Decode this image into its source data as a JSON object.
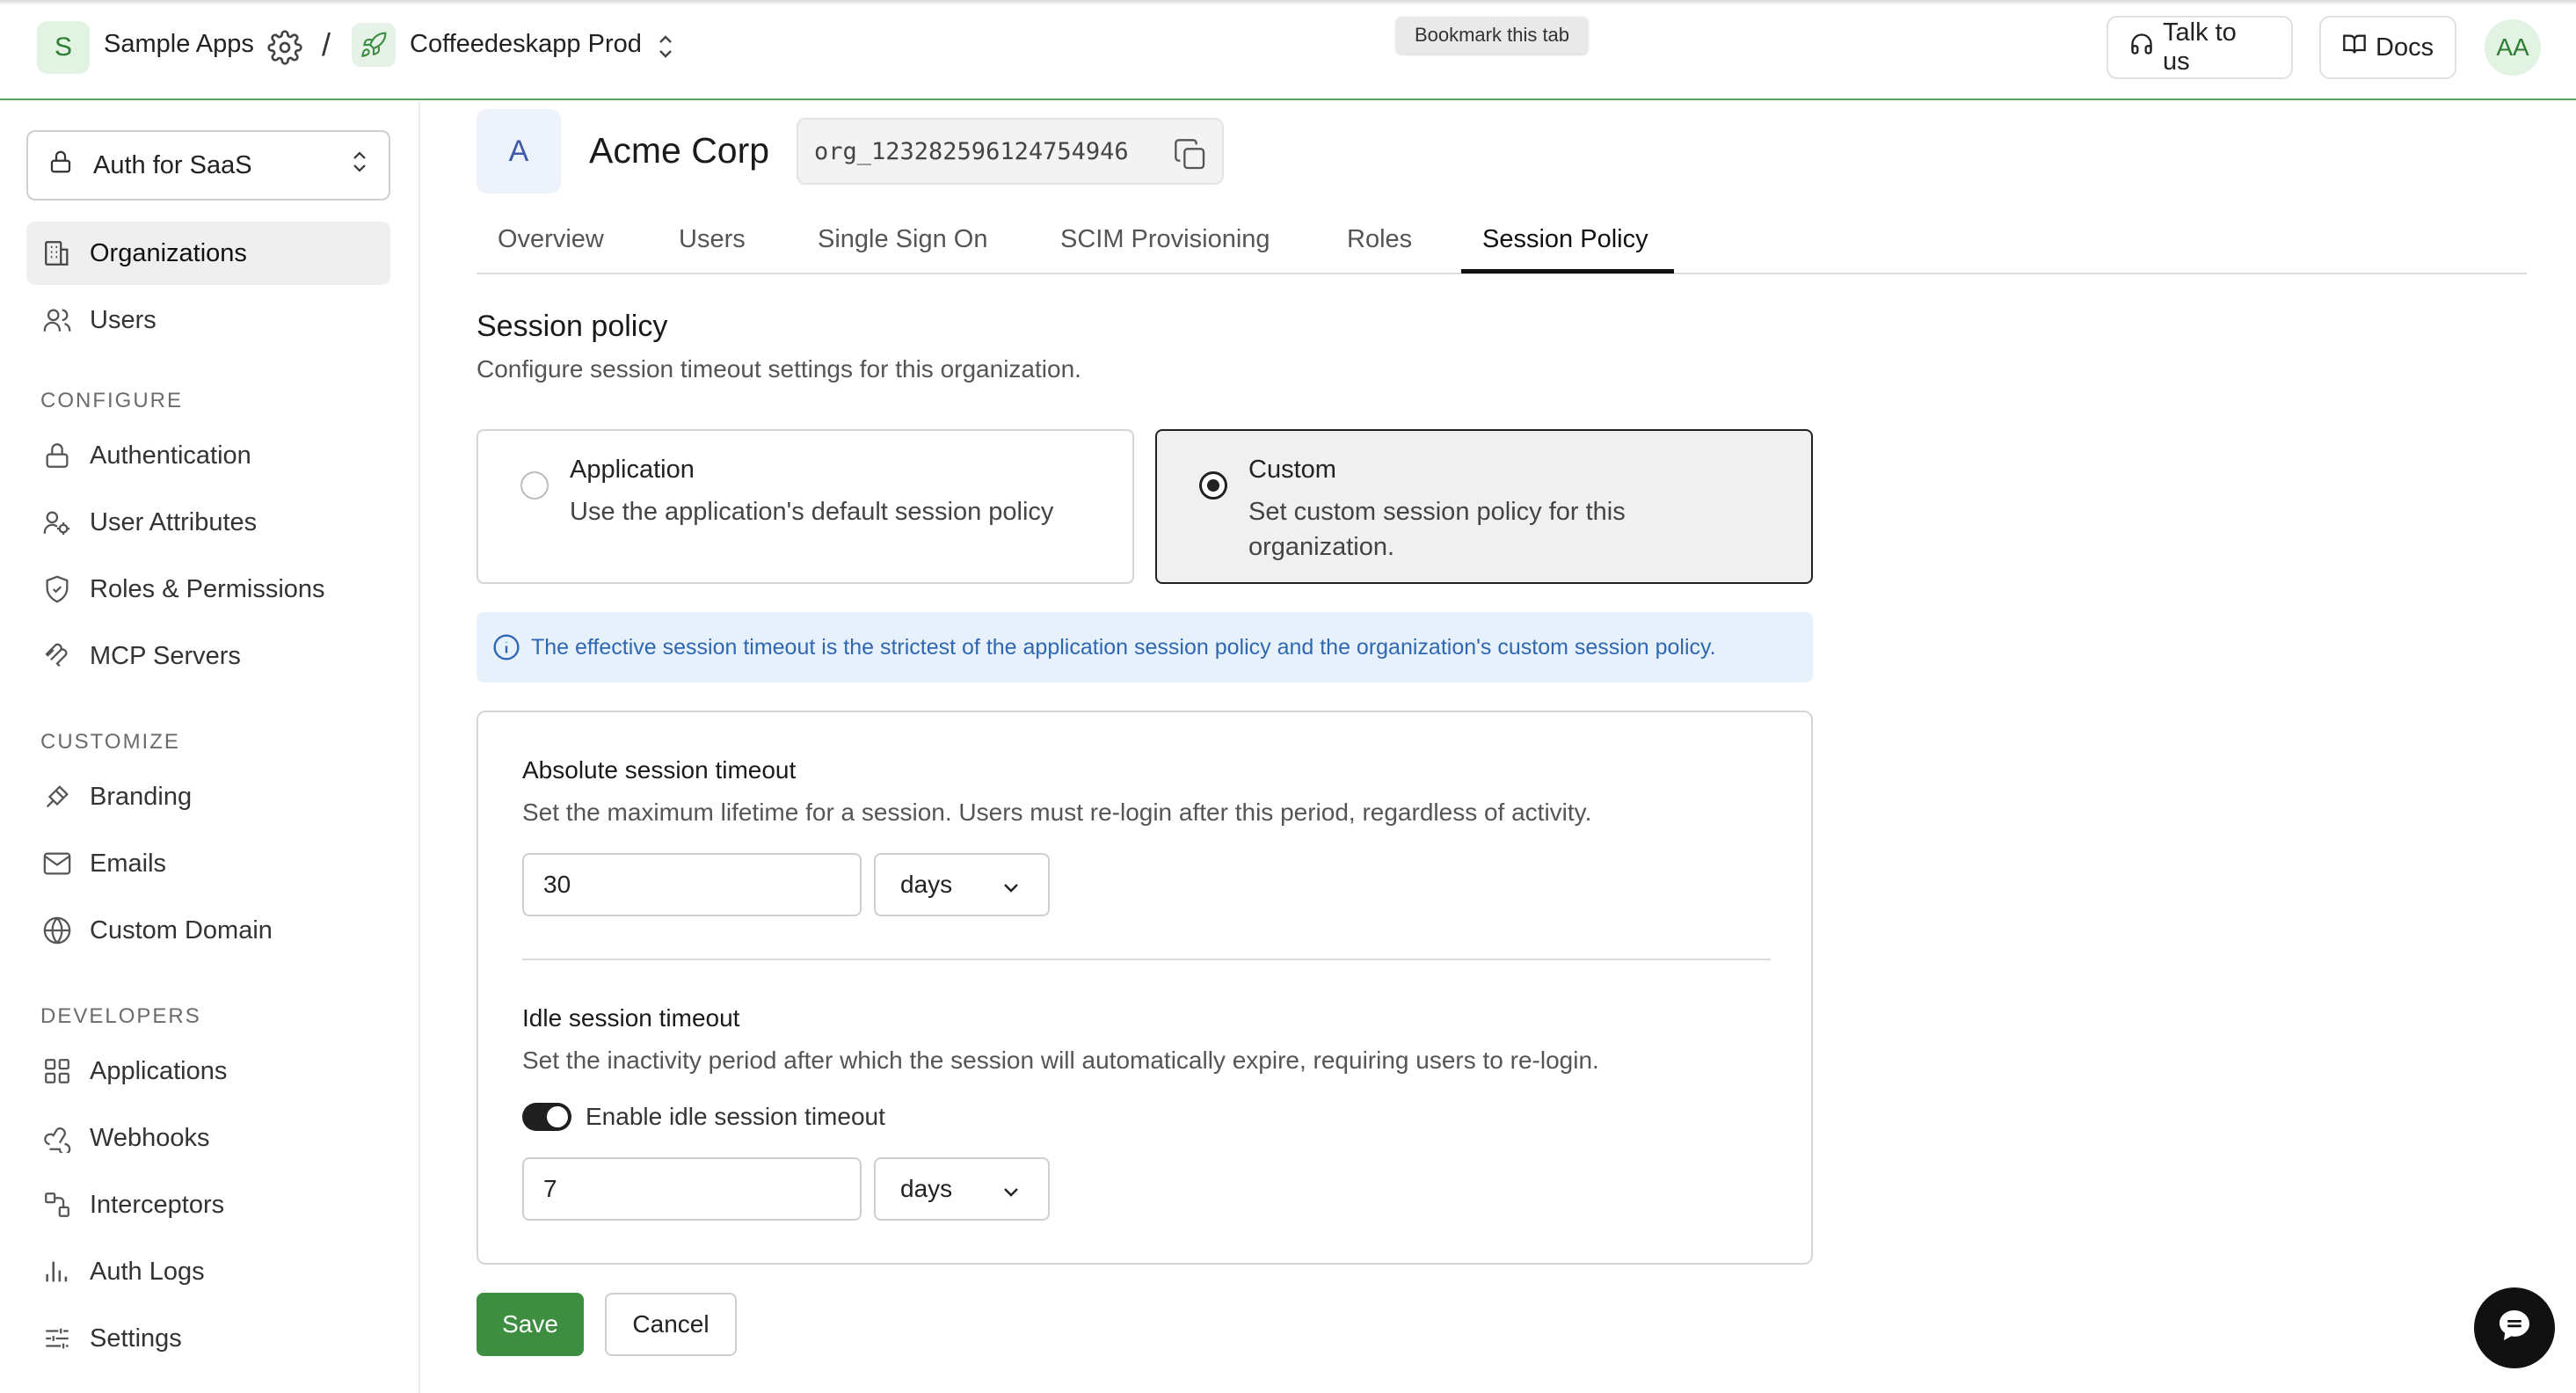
{
  "topbar": {
    "workspace_initial": "S",
    "workspace_name": "Sample Apps",
    "separator": "/",
    "environment_name": "Coffeedeskapp Prod",
    "tooltip": "Bookmark this tab",
    "talk_label": "Talk to us",
    "docs_label": "Docs",
    "user_initials": "AA"
  },
  "sidebar": {
    "app_selector": "Auth for SaaS",
    "primary": [
      {
        "label": "Organizations",
        "icon": "building-icon",
        "active": true
      },
      {
        "label": "Users",
        "icon": "users-icon",
        "active": false
      }
    ],
    "sections": [
      {
        "title": "CONFIGURE",
        "items": [
          {
            "label": "Authentication",
            "icon": "lock-icon"
          },
          {
            "label": "User Attributes",
            "icon": "user-attributes-icon"
          },
          {
            "label": "Roles & Permissions",
            "icon": "shield-icon"
          },
          {
            "label": "MCP Servers",
            "icon": "mcp-icon"
          }
        ]
      },
      {
        "title": "CUSTOMIZE",
        "items": [
          {
            "label": "Branding",
            "icon": "brush-icon"
          },
          {
            "label": "Emails",
            "icon": "mail-icon"
          },
          {
            "label": "Custom Domain",
            "icon": "globe-icon"
          }
        ]
      },
      {
        "title": "DEVELOPERS",
        "items": [
          {
            "label": "Applications",
            "icon": "grid-icon"
          },
          {
            "label": "Webhooks",
            "icon": "webhook-icon"
          },
          {
            "label": "Interceptors",
            "icon": "interceptor-icon"
          },
          {
            "label": "Auth Logs",
            "icon": "bar-chart-icon"
          },
          {
            "label": "Settings",
            "icon": "sliders-icon"
          }
        ]
      }
    ]
  },
  "org": {
    "initial": "A",
    "name": "Acme Corp",
    "id": "org_123282596124754946"
  },
  "tabs": [
    "Overview",
    "Users",
    "Single Sign On",
    "SCIM Provisioning",
    "Roles",
    "Session Policy"
  ],
  "active_tab": "Session Policy",
  "session_policy": {
    "title": "Session policy",
    "subtitle": "Configure session timeout settings for this organization.",
    "options": [
      {
        "title": "Application",
        "desc": "Use the application's default session policy",
        "selected": false
      },
      {
        "title": "Custom",
        "desc": "Set custom session policy for this organization.",
        "selected": true
      }
    ],
    "info": "The effective session timeout is the strictest of the application session policy and the organization's custom session policy.",
    "absolute": {
      "title": "Absolute session timeout",
      "desc": "Set the maximum lifetime for a session. Users must re-login after this period, regardless of activity.",
      "value": "30",
      "unit": "days"
    },
    "idle": {
      "title": "Idle session timeout",
      "desc": "Set the inactivity period after which the session will automatically expire, requiring users to re-login.",
      "toggle_label": "Enable idle session timeout",
      "toggle_on": true,
      "value": "7",
      "unit": "days"
    },
    "save_label": "Save",
    "cancel_label": "Cancel"
  },
  "colors": {
    "accent": "#3e8e41",
    "info_bg": "#e7f1fc",
    "info_text": "#2f67b1"
  }
}
